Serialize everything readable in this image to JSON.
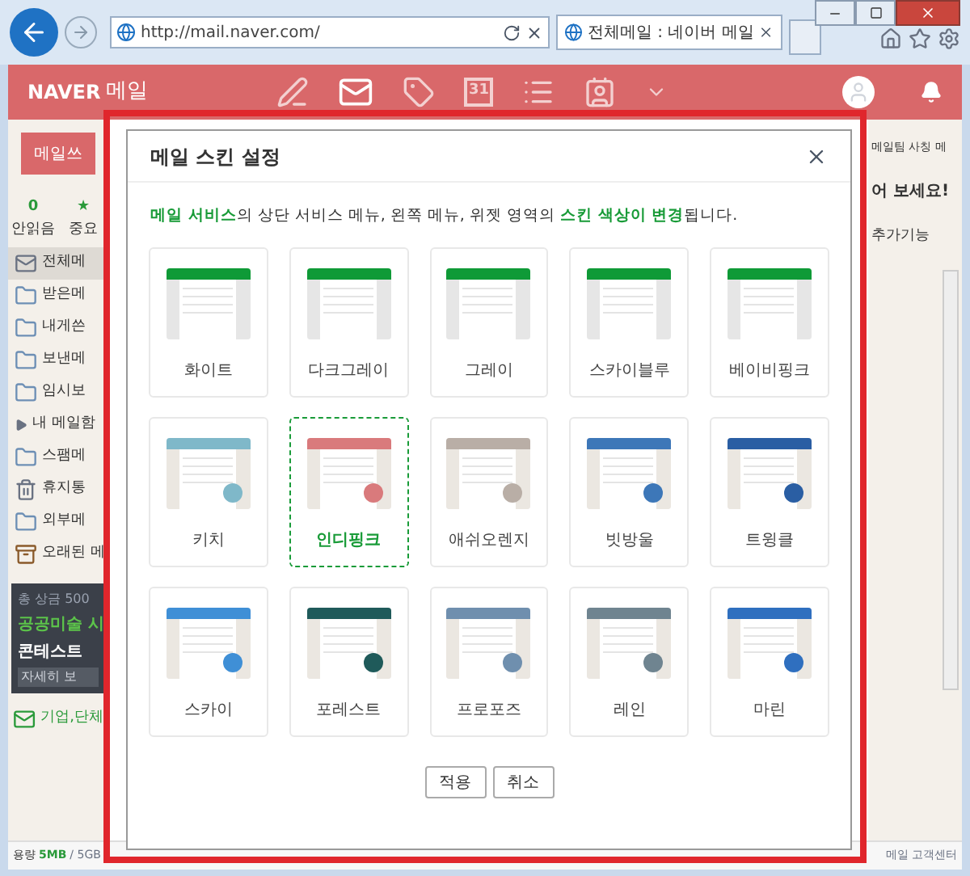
{
  "browser": {
    "address": "http://mail.naver.com/",
    "tab_title": "전체메일 : 네이버 메일"
  },
  "header": {
    "logo": "NAVER",
    "service": "메일",
    "date_badge": "31"
  },
  "sidebar": {
    "compose": "메일쓰",
    "counters": [
      {
        "count": "0",
        "label": "안읽음"
      },
      {
        "count": "★",
        "label": "중요"
      }
    ],
    "folders": [
      {
        "kind": "mail",
        "label": "전체메",
        "selected": true
      },
      {
        "kind": "folder",
        "label": "받은메",
        "selected": false
      },
      {
        "kind": "folder",
        "label": "내게쓴",
        "selected": false
      },
      {
        "kind": "folder",
        "label": "보낸메",
        "selected": false
      },
      {
        "kind": "folder",
        "label": "임시보",
        "selected": false
      },
      {
        "kind": "group",
        "label": "내 메일함",
        "selected": false
      },
      {
        "kind": "folder",
        "label": "스팸메",
        "selected": false
      },
      {
        "kind": "trash",
        "label": "휴지통",
        "selected": false
      },
      {
        "kind": "folder",
        "label": "외부메",
        "selected": false
      },
      {
        "kind": "box",
        "label": "오래된 메",
        "selected": false
      }
    ],
    "ad": {
      "line1": "총 상금 500",
      "line2": "공공미술 시",
      "line3": "콘테스트",
      "button": "자세히 보"
    },
    "business": "기업,단체"
  },
  "right": {
    "notice": "메일팀 사칭 메",
    "banner": "어 보세요!",
    "extra": "추가기능"
  },
  "footer": {
    "usage_label": "용량",
    "usage": "5MB",
    "usage_total": "/ 5GB",
    "help": "메일 고객센터"
  },
  "dialog": {
    "title": "메일 스킨 설정",
    "description": "**메일 서비스**의 상단 서비스 메뉴, 왼쪽 메뉴, 위젯 영역의 **스킨 색상이 변경**됩니다.",
    "skins": [
      {
        "label": "화이트",
        "kind": "basic",
        "color": "#0f9a37",
        "selected": false
      },
      {
        "label": "다크그레이",
        "kind": "basic",
        "color": "#0f9a37",
        "selected": false
      },
      {
        "label": "그레이",
        "kind": "basic",
        "color": "#0f9a37",
        "selected": false
      },
      {
        "label": "스카이블루",
        "kind": "basic",
        "color": "#0f9a37",
        "selected": false
      },
      {
        "label": "베이비핑크",
        "kind": "basic",
        "color": "#0f9a37",
        "selected": false
      },
      {
        "label": "키치",
        "kind": "illustrated",
        "color": "#7fb8c9",
        "selected": false
      },
      {
        "label": "인디핑크",
        "kind": "illustrated",
        "color": "#d97a7c",
        "selected": true
      },
      {
        "label": "애쉬오렌지",
        "kind": "illustrated",
        "color": "#b9aea6",
        "selected": false
      },
      {
        "label": "빗방울",
        "kind": "illustrated",
        "color": "#3d77b8",
        "selected": false
      },
      {
        "label": "트윙클",
        "kind": "illustrated",
        "color": "#2a5ea3",
        "selected": false
      },
      {
        "label": "스카이",
        "kind": "illustrated",
        "color": "#3f8fd6",
        "selected": false
      },
      {
        "label": "포레스트",
        "kind": "illustrated",
        "color": "#1f5a5a",
        "selected": false
      },
      {
        "label": "프로포즈",
        "kind": "illustrated",
        "color": "#6f8fae",
        "selected": false
      },
      {
        "label": "레인",
        "kind": "illustrated",
        "color": "#6f8490",
        "selected": false
      },
      {
        "label": "마린",
        "kind": "illustrated",
        "color": "#2f6fbf",
        "selected": false
      }
    ],
    "buttons": [
      "적용",
      "취소"
    ]
  }
}
